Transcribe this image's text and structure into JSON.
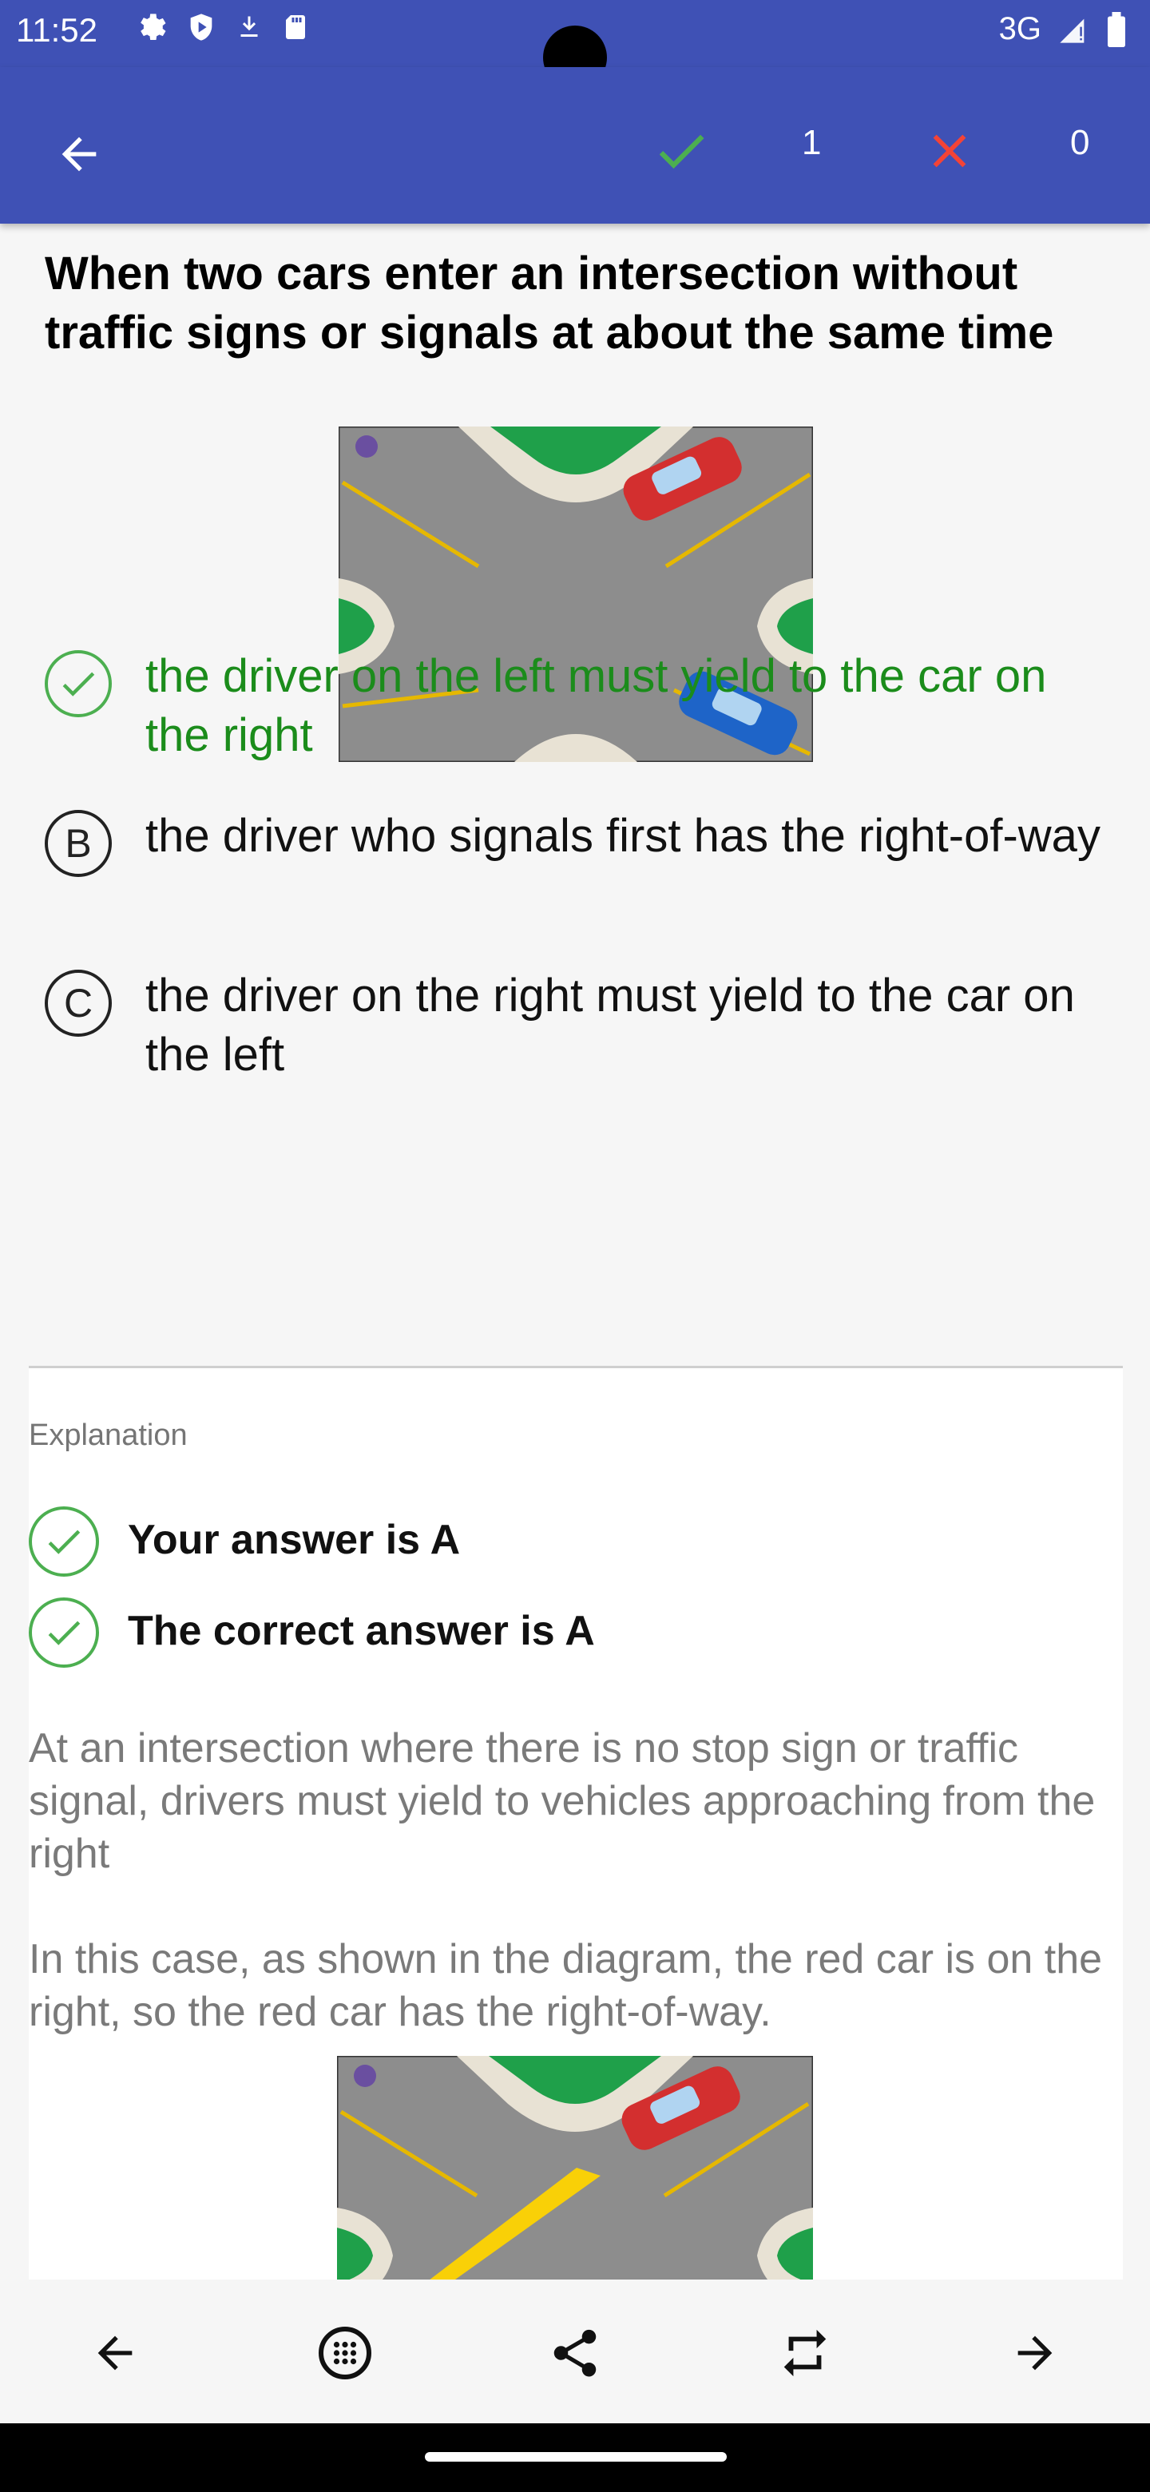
{
  "status_bar": {
    "time": "11:52",
    "network": "3G"
  },
  "app_bar": {
    "correct_count": "1",
    "wrong_count": "0"
  },
  "question": {
    "text": "When two cars enter an intersection without traffic signs or signals at about the same time",
    "answers": [
      {
        "marker": "",
        "text": "the driver on the left must yield to the car on the right",
        "state": "correct"
      },
      {
        "marker": "B",
        "text": "the driver who signals first has the right-of-way",
        "state": "normal"
      },
      {
        "marker": "C",
        "text": "the driver on the right must yield to the car on the left",
        "state": "normal"
      }
    ]
  },
  "explanation": {
    "title": "Explanation",
    "your_answer": "Your answer is A",
    "correct_answer": "The correct answer is A",
    "para1": "At an intersection where there is no stop sign or traffic signal, drivers must yield to vehicles approaching from the right",
    "para2": "In this case, as shown in the diagram, the red car is on the right, so the red car has the right-of-way."
  },
  "colors": {
    "primary": "#3f51b5",
    "correct_green": "#1b8c1b",
    "wrong_red": "#f44336",
    "check_green": "#4caf50"
  },
  "icons": [
    "back-arrow-icon",
    "check-icon",
    "close-icon",
    "grid-icon",
    "share-icon",
    "repeat-icon",
    "forward-arrow-icon"
  ]
}
